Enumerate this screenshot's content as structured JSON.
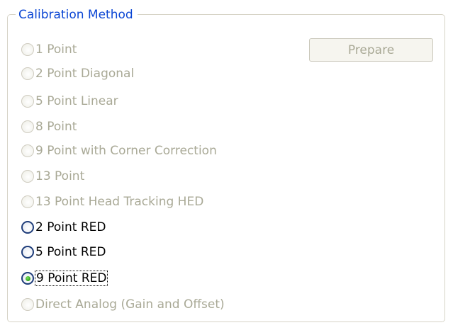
{
  "groupbox": {
    "title": "Calibration Method"
  },
  "prepare_button": {
    "label": "Prepare",
    "enabled": false
  },
  "options": [
    {
      "label": "1 Point",
      "enabled": false,
      "selected": false
    },
    {
      "label": "2 Point Diagonal",
      "enabled": false,
      "selected": false
    },
    {
      "label": "5 Point Linear",
      "enabled": false,
      "selected": false
    },
    {
      "label": "8 Point",
      "enabled": false,
      "selected": false
    },
    {
      "label": "9 Point with Corner Correction",
      "enabled": false,
      "selected": false
    },
    {
      "label": "13 Point",
      "enabled": false,
      "selected": false
    },
    {
      "label": "13 Point Head Tracking HED",
      "enabled": false,
      "selected": false
    },
    {
      "label": "2 Point RED",
      "enabled": true,
      "selected": false
    },
    {
      "label": "5 Point RED",
      "enabled": true,
      "selected": false
    },
    {
      "label": "9 Point RED",
      "enabled": true,
      "selected": true
    },
    {
      "label": "Direct Analog (Gain and Offset)",
      "enabled": false,
      "selected": false
    }
  ],
  "colors": {
    "title": "#0b46d4",
    "disabled_text": "#a9a996",
    "enabled_text": "#000000",
    "border": "#d6d3c6",
    "radio_enabled_border": "#1f3d7a",
    "radio_selected_dot": "#29a219"
  }
}
